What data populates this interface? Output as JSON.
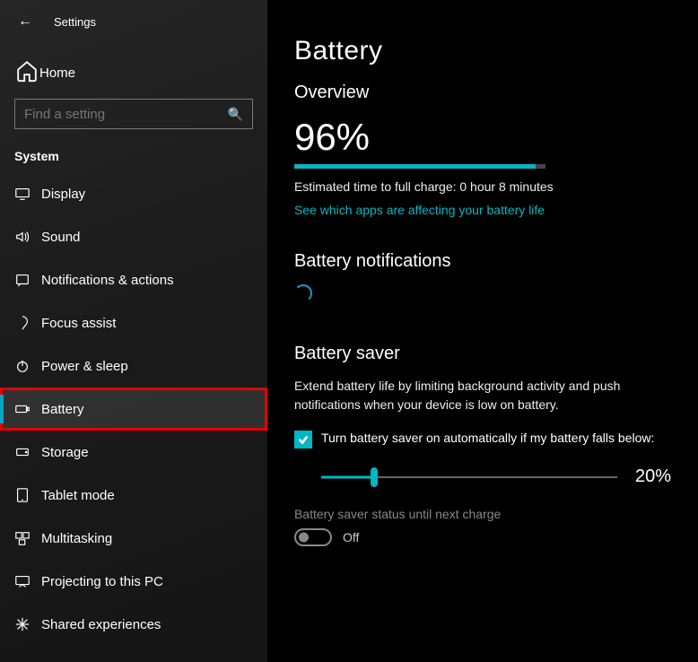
{
  "window": {
    "title": "Settings"
  },
  "sidebar": {
    "home": "Home",
    "search_placeholder": "Find a setting",
    "section": "System",
    "items": [
      {
        "label": "Display"
      },
      {
        "label": "Sound"
      },
      {
        "label": "Notifications & actions"
      },
      {
        "label": "Focus assist"
      },
      {
        "label": "Power & sleep"
      },
      {
        "label": "Battery"
      },
      {
        "label": "Storage"
      },
      {
        "label": "Tablet mode"
      },
      {
        "label": "Multitasking"
      },
      {
        "label": "Projecting to this PC"
      },
      {
        "label": "Shared experiences"
      }
    ]
  },
  "main": {
    "title": "Battery",
    "overview_heading": "Overview",
    "percentage": "96%",
    "charge_text": "Estimated time to full charge: 0 hour 8 minutes",
    "apps_link": "See which apps are affecting your battery life",
    "notifications_heading": "Battery notifications",
    "saver_heading": "Battery saver",
    "saver_desc": "Extend battery life by limiting background activity and push notifications when your device is low on battery.",
    "auto_checkbox_label": "Turn battery saver on automatically if my battery falls below:",
    "slider_value": "20%",
    "status_label": "Battery saver status until next charge",
    "toggle_text": "Off"
  }
}
